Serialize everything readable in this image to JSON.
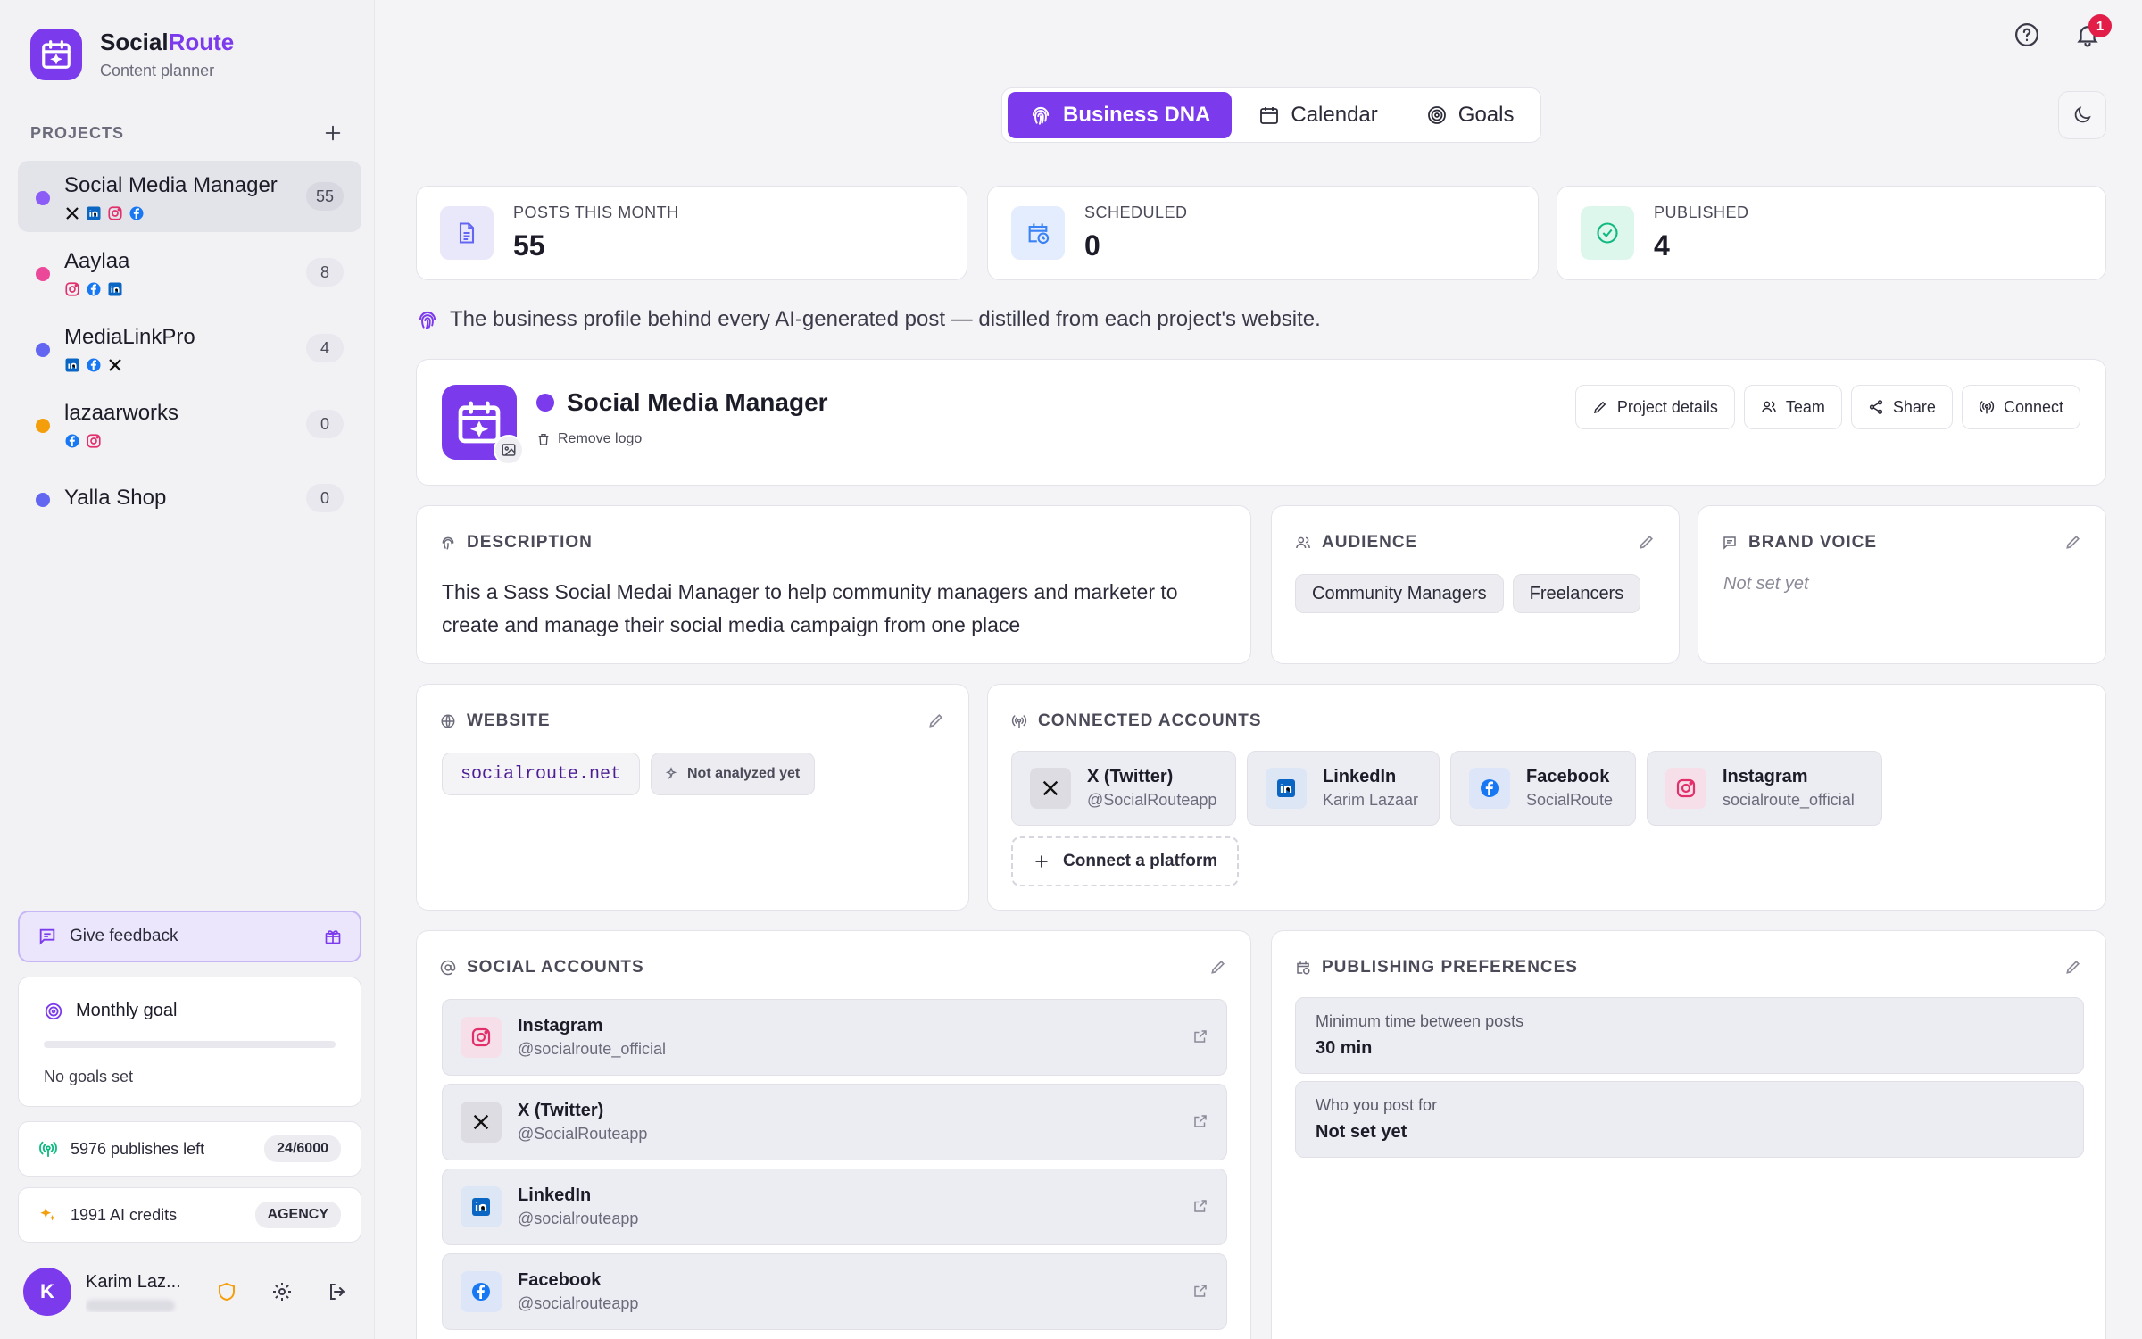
{
  "brand": {
    "name_a": "Social",
    "name_b": "Route",
    "subtitle": "Content planner",
    "accent": "#7c3aed"
  },
  "sidebar": {
    "projects_label": "PROJECTS",
    "projects": [
      {
        "name": "Social Media Manager",
        "count": "55",
        "color": "#8b5cf6",
        "platforms": [
          "x-icon",
          "linkedin-icon",
          "instagram-icon",
          "facebook-icon"
        ]
      },
      {
        "name": "Aaylaa",
        "count": "8",
        "color": "#ec4899",
        "platforms": [
          "instagram-icon",
          "facebook-icon",
          "linkedin-icon"
        ]
      },
      {
        "name": "MediaLinkPro",
        "count": "4",
        "color": "#6366f1",
        "platforms": [
          "linkedin-icon",
          "facebook-icon",
          "x-icon"
        ]
      },
      {
        "name": "lazaarworks",
        "count": "0",
        "color": "#f59e0b",
        "platforms": [
          "facebook-icon",
          "instagram-icon"
        ]
      },
      {
        "name": "Yalla Shop",
        "count": "0",
        "color": "#6366f1",
        "platforms": []
      }
    ],
    "feedback_label": "Give feedback",
    "goal": {
      "title": "Monthly goal",
      "progress": 0,
      "empty_text": "No goals set"
    },
    "publishes": {
      "label": "5976 publishes left",
      "badge": "24/6000"
    },
    "credits": {
      "label": "1991 AI credits",
      "badge": "AGENCY"
    },
    "user": {
      "name": "Karim Laz...",
      "initial": "K"
    }
  },
  "header": {
    "notification_count": "1"
  },
  "tabs": [
    {
      "label": "Business DNA",
      "icon": "fingerprint-icon",
      "active": true
    },
    {
      "label": "Calendar",
      "icon": "calendar-icon",
      "active": false
    },
    {
      "label": "Goals",
      "icon": "target-icon",
      "active": false
    }
  ],
  "stats": [
    {
      "label": "POSTS THIS MONTH",
      "value": "55",
      "icon": "document-icon",
      "color": "#6366f1"
    },
    {
      "label": "SCHEDULED",
      "value": "0",
      "icon": "calendar-clock-icon",
      "color": "#3b82f6"
    },
    {
      "label": "PUBLISHED",
      "value": "4",
      "icon": "check-circle-icon",
      "color": "#10b981"
    }
  ],
  "intro_text": "The business profile behind every AI-generated post — distilled from each project's website.",
  "profile": {
    "name": "Social Media Manager",
    "remove_logo": "Remove logo",
    "actions": [
      "Project details",
      "Team",
      "Share",
      "Connect"
    ]
  },
  "description": {
    "title": "DESCRIPTION",
    "text": "This a Sass Social Medai Manager to help community managers and marketer to create and manage their social media campaign from one place"
  },
  "audience": {
    "title": "AUDIENCE",
    "tags": [
      "Community Managers",
      "Freelancers"
    ]
  },
  "brand_voice": {
    "title": "BRAND VOICE",
    "value": "Not set yet"
  },
  "website": {
    "title": "WEBSITE",
    "url": "socialroute.net",
    "status": "Not analyzed yet"
  },
  "connected_accounts": {
    "title": "CONNECTED ACCOUNTS",
    "accounts": [
      {
        "platform": "X (Twitter)",
        "handle": "@SocialRouteapp"
      },
      {
        "platform": "LinkedIn",
        "handle": "Karim Lazaar"
      },
      {
        "platform": "Facebook",
        "handle": "SocialRoute"
      },
      {
        "platform": "Instagram",
        "handle": "socialroute_official"
      }
    ],
    "connect_label": "Connect a platform"
  },
  "social_accounts": {
    "title": "SOCIAL ACCOUNTS",
    "items": [
      {
        "platform": "Instagram",
        "handle": "@socialroute_official"
      },
      {
        "platform": "X (Twitter)",
        "handle": "@SocialRouteapp"
      },
      {
        "platform": "LinkedIn",
        "handle": "@socialrouteapp"
      },
      {
        "platform": "Facebook",
        "handle": "@socialrouteapp"
      }
    ]
  },
  "publishing_preferences": {
    "title": "PUBLISHING PREFERENCES",
    "items": [
      {
        "label": "Minimum time between posts",
        "value": "30 min"
      },
      {
        "label": "Who you post for",
        "value": "Not set yet"
      }
    ]
  }
}
